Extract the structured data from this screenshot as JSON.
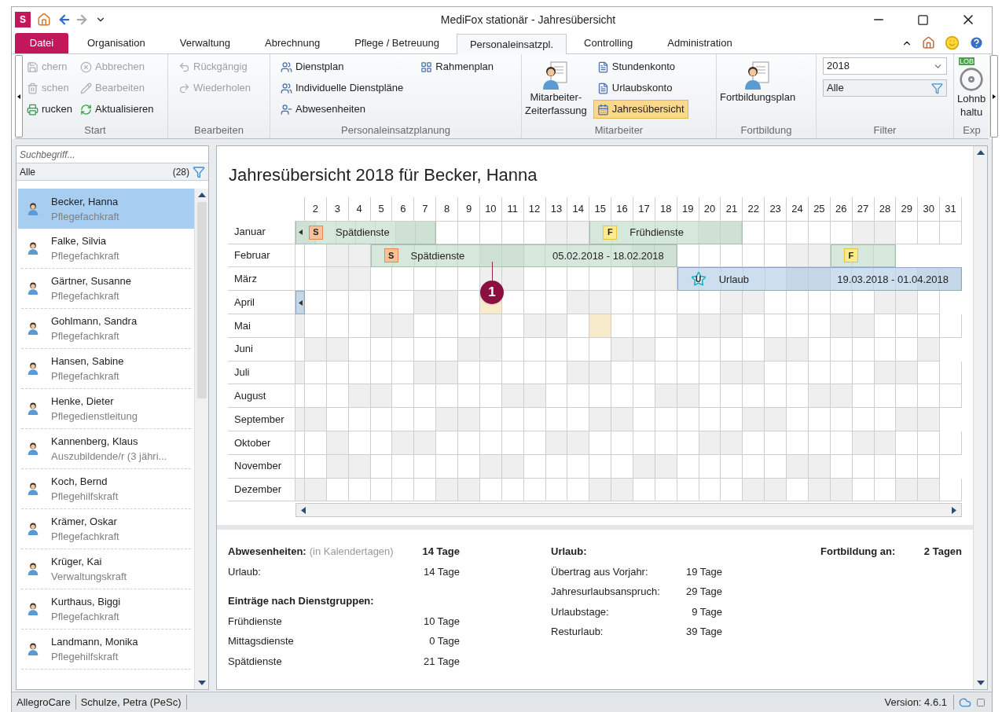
{
  "window": {
    "app_logo": "S",
    "title": "MediFox stationär - Jahresübersicht"
  },
  "tabs": [
    {
      "label": "Datei",
      "kind": "file",
      "selected": false
    },
    {
      "label": "Organisation",
      "kind": "tab",
      "selected": false
    },
    {
      "label": "Verwaltung",
      "kind": "tab",
      "selected": false
    },
    {
      "label": "Abrechnung",
      "kind": "tab",
      "selected": false
    },
    {
      "label": "Pflege / Betreuung",
      "kind": "tab",
      "selected": false
    },
    {
      "label": "Personaleinsatzpl.",
      "kind": "tab",
      "selected": true
    },
    {
      "label": "Controlling",
      "kind": "tab",
      "selected": false
    },
    {
      "label": "Administration",
      "kind": "tab",
      "selected": false
    }
  ],
  "ribbon": {
    "groups": [
      {
        "label": "Start",
        "columns": [
          {
            "kind": "stack",
            "items": [
              {
                "label": "chern",
                "disabled": true,
                "selected": false
              },
              {
                "label": "schen",
                "disabled": true,
                "selected": false
              },
              {
                "label": "rucken",
                "disabled": false,
                "selected": false
              }
            ]
          },
          {
            "kind": "stack",
            "items": [
              {
                "label": "Abbrechen",
                "disabled": true,
                "selected": false
              },
              {
                "label": "Bearbeiten",
                "disabled": true,
                "selected": false
              },
              {
                "label": "Aktualisieren",
                "disabled": false,
                "selected": false
              }
            ]
          }
        ]
      },
      {
        "label": "Bearbeiten",
        "columns": [
          {
            "kind": "stack",
            "items": [
              {
                "label": "Rückgängig",
                "disabled": true,
                "selected": false
              },
              {
                "label": "Wiederholen",
                "disabled": true,
                "selected": false
              }
            ]
          }
        ]
      },
      {
        "label": "Personaleinsatzplanung",
        "columns": [
          {
            "kind": "stack",
            "items": [
              {
                "label": "Dienstplan",
                "disabled": false,
                "selected": false
              },
              {
                "label": "Individuelle Dienstpläne",
                "disabled": false,
                "selected": false
              },
              {
                "label": "Abwesenheiten",
                "disabled": false,
                "selected": false
              }
            ]
          },
          {
            "kind": "stack",
            "items": [
              {
                "label": "Rahmenplan",
                "disabled": false,
                "selected": false
              }
            ]
          }
        ]
      },
      {
        "label": "Mitarbeiter",
        "columns": [
          {
            "kind": "large",
            "lines": [
              "Mitarbeiter-",
              "Zeiterfassung"
            ]
          },
          {
            "kind": "stack",
            "items": [
              {
                "label": "Stundenkonto",
                "disabled": false,
                "selected": false
              },
              {
                "label": "Urlaubskonto",
                "disabled": false,
                "selected": false
              },
              {
                "label": "Jahresübersicht",
                "disabled": false,
                "selected": true
              }
            ]
          }
        ]
      },
      {
        "label": "Fortbildung",
        "columns": [
          {
            "kind": "large",
            "lines": [
              "Fortbildungsplan"
            ]
          }
        ]
      },
      {
        "label": "Filter",
        "columns": [
          {
            "kind": "filter",
            "year": "2018",
            "scope": "Alle"
          }
        ]
      },
      {
        "label": "Exp",
        "columns": [
          {
            "kind": "large",
            "badge": "LOB",
            "lines": [
              "Lohnb",
              "haltu"
            ]
          }
        ]
      }
    ]
  },
  "sidebar": {
    "search": {
      "placeholder": "Suchbegriff..."
    },
    "filter": {
      "label": "Alle",
      "count": "(28)"
    },
    "items": [
      {
        "name": "Becker, Hanna",
        "role": "Pflegefachkraft",
        "selected": true
      },
      {
        "name": "Falke, Silvia",
        "role": "Pflegefachkraft",
        "selected": false
      },
      {
        "name": "Gärtner, Susanne",
        "role": "Pflegefachkraft",
        "selected": false
      },
      {
        "name": "Gohlmann, Sandra",
        "role": "Pflegefachkraft",
        "selected": false
      },
      {
        "name": "Hansen, Sabine",
        "role": "Pflegefachkraft",
        "selected": false
      },
      {
        "name": "Henke, Dieter",
        "role": "Pflegedienstleitung",
        "selected": false
      },
      {
        "name": "Kannenberg, Klaus",
        "role": "Auszubildende/r (3 jähri...",
        "selected": false
      },
      {
        "name": "Koch, Bernd",
        "role": "Pflegehilfskraft",
        "selected": false
      },
      {
        "name": "Krämer, Oskar",
        "role": "Pflegefachkraft",
        "selected": false
      },
      {
        "name": "Krüger, Kai",
        "role": "Verwaltungskraft",
        "selected": false
      },
      {
        "name": "Kurthaus, Biggi",
        "role": "Pflegefachkraft",
        "selected": false
      },
      {
        "name": "Landmann, Monika",
        "role": "Pflegehilfskraft",
        "selected": false
      }
    ]
  },
  "calendar": {
    "title": "Jahresübersicht 2018 für Becker, Hanna",
    "callout": "1",
    "days": [
      "2",
      "3",
      "4",
      "5",
      "6",
      "7",
      "8",
      "9",
      "10",
      "11",
      "12",
      "13",
      "14",
      "15",
      "16",
      "17",
      "18",
      "19",
      "20",
      "21",
      "22",
      "23",
      "24",
      "25",
      "26",
      "27",
      "28",
      "29",
      "30",
      "31"
    ],
    "months": [
      {
        "name": "Januar",
        "cells": [
          {
            "kind": "shift",
            "continues_left": true,
            "badge": {
              "kind": "late",
              "letter": "S"
            },
            "label": "Spätdienste",
            "days": [
              {
                "kind": "shaded"
              },
              {
                "kind": "plain"
              },
              {
                "kind": "plain"
              },
              {
                "kind": "plain"
              },
              {
                "kind": "plain"
              },
              {
                "kind": "shaded"
              },
              {
                "kind": "shaded"
              }
            ]
          },
          {
            "kind": "plain"
          },
          {
            "kind": "plain"
          },
          {
            "kind": "plain"
          },
          {
            "kind": "plain"
          },
          {
            "kind": "plain"
          },
          {
            "kind": "shaded"
          },
          {
            "kind": "shaded"
          },
          {
            "kind": "shift",
            "continues_left": false,
            "badge": {
              "kind": "early",
              "letter": "F"
            },
            "label": "Frühdienste",
            "days": [
              {
                "kind": "plain"
              },
              {
                "kind": "plain"
              },
              {
                "kind": "plain"
              },
              {
                "kind": "plain"
              },
              {
                "kind": "plain"
              },
              {
                "kind": "shaded"
              },
              {
                "kind": "shaded"
              }
            ]
          },
          {
            "kind": "plain"
          },
          {
            "kind": "plain"
          },
          {
            "kind": "plain"
          },
          {
            "kind": "plain"
          },
          {
            "kind": "plain"
          },
          {
            "kind": "shaded"
          },
          {
            "kind": "shaded"
          },
          {
            "kind": "plain"
          },
          {
            "kind": "plain"
          },
          {
            "kind": "plain"
          }
        ]
      },
      {
        "name": "Februar",
        "cells": [
          {
            "kind": "plain"
          },
          {
            "kind": "plain"
          },
          {
            "kind": "shaded"
          },
          {
            "kind": "shaded"
          },
          {
            "kind": "shift",
            "continues_left": false,
            "badge": {
              "kind": "late",
              "letter": "S"
            },
            "label": "Spätdienste",
            "range": "05.02.2018 - 18.02.2018",
            "days": [
              {
                "kind": "plain"
              },
              {
                "kind": "plain"
              },
              {
                "kind": "plain"
              },
              {
                "kind": "plain"
              },
              {
                "kind": "plain"
              },
              {
                "kind": "shaded"
              },
              {
                "kind": "shaded"
              },
              {
                "kind": "plain"
              },
              {
                "kind": "plain"
              },
              {
                "kind": "plain"
              },
              {
                "kind": "plain"
              },
              {
                "kind": "plain"
              },
              {
                "kind": "shaded"
              },
              {
                "kind": "shaded"
              }
            ]
          },
          {
            "kind": "plain"
          },
          {
            "kind": "plain"
          },
          {
            "kind": "plain"
          },
          {
            "kind": "plain"
          },
          {
            "kind": "plain"
          },
          {
            "kind": "shaded"
          },
          {
            "kind": "shaded"
          },
          {
            "kind": "shift",
            "continues_left": false,
            "badge": {
              "kind": "early",
              "letter": "F"
            },
            "days": [
              {
                "kind": "plain"
              },
              {
                "kind": "plain"
              },
              {
                "kind": "plain"
              }
            ]
          }
        ]
      },
      {
        "name": "März",
        "cells": [
          {
            "kind": "plain"
          },
          {
            "kind": "plain"
          },
          {
            "kind": "shaded"
          },
          {
            "kind": "shaded"
          },
          {
            "kind": "plain"
          },
          {
            "kind": "plain"
          },
          {
            "kind": "plain"
          },
          {
            "kind": "plain"
          },
          {
            "kind": "plain"
          },
          {
            "kind": "shaded"
          },
          {
            "kind": "shaded"
          },
          {
            "kind": "plain"
          },
          {
            "kind": "plain"
          },
          {
            "kind": "plain"
          },
          {
            "kind": "plain"
          },
          {
            "kind": "plain"
          },
          {
            "kind": "shaded"
          },
          {
            "kind": "shaded"
          },
          {
            "kind": "vacation",
            "continues_left": false,
            "badge": {
              "kind": "vacation",
              "letter": "U"
            },
            "label": "Urlaub",
            "range": "19.03.2018 - 01.04.2018",
            "days": [
              {
                "kind": "plain"
              },
              {
                "kind": "plain"
              },
              {
                "kind": "plain"
              },
              {
                "kind": "plain"
              },
              {
                "kind": "plain"
              },
              {
                "kind": "shaded"
              },
              {
                "kind": "shaded"
              },
              {
                "kind": "plain"
              },
              {
                "kind": "plain"
              },
              {
                "kind": "plain"
              },
              {
                "kind": "plain"
              },
              {
                "kind": "shaded"
              },
              {
                "kind": "shaded"
              }
            ]
          }
        ]
      },
      {
        "name": "April",
        "cells": [
          {
            "kind": "vacation",
            "continues_left": true,
            "days": [
              {
                "kind": "shaded"
              }
            ]
          },
          {
            "kind": "plain"
          },
          {
            "kind": "plain"
          },
          {
            "kind": "plain"
          },
          {
            "kind": "plain"
          },
          {
            "kind": "plain"
          },
          {
            "kind": "shaded"
          },
          {
            "kind": "shaded"
          },
          {
            "kind": "plain"
          },
          {
            "kind": "marked"
          },
          {
            "kind": "plain"
          },
          {
            "kind": "plain"
          },
          {
            "kind": "plain"
          },
          {
            "kind": "shaded"
          },
          {
            "kind": "shaded"
          },
          {
            "kind": "plain"
          },
          {
            "kind": "plain"
          },
          {
            "kind": "plain"
          },
          {
            "kind": "plain"
          },
          {
            "kind": "plain"
          },
          {
            "kind": "shaded"
          },
          {
            "kind": "shaded"
          },
          {
            "kind": "plain"
          },
          {
            "kind": "plain"
          },
          {
            "kind": "plain"
          },
          {
            "kind": "plain"
          },
          {
            "kind": "plain"
          },
          {
            "kind": "shaded"
          },
          {
            "kind": "shaded"
          },
          {
            "kind": "plain"
          }
        ]
      },
      {
        "name": "Mai",
        "cells": [
          {
            "kind": "shaded"
          },
          {
            "kind": "plain"
          },
          {
            "kind": "plain"
          },
          {
            "kind": "plain"
          },
          {
            "kind": "shaded"
          },
          {
            "kind": "shaded"
          },
          {
            "kind": "plain"
          },
          {
            "kind": "plain"
          },
          {
            "kind": "plain"
          },
          {
            "kind": "shaded"
          },
          {
            "kind": "plain"
          },
          {
            "kind": "shaded"
          },
          {
            "kind": "shaded"
          },
          {
            "kind": "plain"
          },
          {
            "kind": "marked"
          },
          {
            "kind": "plain"
          },
          {
            "kind": "plain"
          },
          {
            "kind": "plain"
          },
          {
            "kind": "shaded"
          },
          {
            "kind": "shaded"
          },
          {
            "kind": "shaded"
          },
          {
            "kind": "plain"
          },
          {
            "kind": "plain"
          },
          {
            "kind": "plain"
          },
          {
            "kind": "plain"
          },
          {
            "kind": "shaded"
          },
          {
            "kind": "shaded"
          },
          {
            "kind": "plain"
          },
          {
            "kind": "plain"
          },
          {
            "kind": "plain"
          },
          {
            "kind": "plain"
          }
        ]
      },
      {
        "name": "Juni",
        "cells": [
          {
            "kind": "plain"
          },
          {
            "kind": "shaded"
          },
          {
            "kind": "shaded"
          },
          {
            "kind": "plain"
          },
          {
            "kind": "plain"
          },
          {
            "kind": "plain"
          },
          {
            "kind": "plain"
          },
          {
            "kind": "plain"
          },
          {
            "kind": "shaded"
          },
          {
            "kind": "shaded"
          },
          {
            "kind": "plain"
          },
          {
            "kind": "plain"
          },
          {
            "kind": "plain"
          },
          {
            "kind": "plain"
          },
          {
            "kind": "plain"
          },
          {
            "kind": "shaded"
          },
          {
            "kind": "shaded"
          },
          {
            "kind": "plain"
          },
          {
            "kind": "plain"
          },
          {
            "kind": "plain"
          },
          {
            "kind": "plain"
          },
          {
            "kind": "plain"
          },
          {
            "kind": "shaded"
          },
          {
            "kind": "shaded"
          },
          {
            "kind": "plain"
          },
          {
            "kind": "plain"
          },
          {
            "kind": "plain"
          },
          {
            "kind": "plain"
          },
          {
            "kind": "plain"
          },
          {
            "kind": "shaded"
          }
        ]
      },
      {
        "name": "Juli",
        "cells": [
          {
            "kind": "shaded"
          },
          {
            "kind": "plain"
          },
          {
            "kind": "plain"
          },
          {
            "kind": "plain"
          },
          {
            "kind": "plain"
          },
          {
            "kind": "plain"
          },
          {
            "kind": "shaded"
          },
          {
            "kind": "shaded"
          },
          {
            "kind": "plain"
          },
          {
            "kind": "plain"
          },
          {
            "kind": "plain"
          },
          {
            "kind": "plain"
          },
          {
            "kind": "plain"
          },
          {
            "kind": "shaded"
          },
          {
            "kind": "shaded"
          },
          {
            "kind": "plain"
          },
          {
            "kind": "plain"
          },
          {
            "kind": "plain"
          },
          {
            "kind": "plain"
          },
          {
            "kind": "plain"
          },
          {
            "kind": "shaded"
          },
          {
            "kind": "shaded"
          },
          {
            "kind": "plain"
          },
          {
            "kind": "plain"
          },
          {
            "kind": "plain"
          },
          {
            "kind": "plain"
          },
          {
            "kind": "plain"
          },
          {
            "kind": "shaded"
          },
          {
            "kind": "shaded"
          },
          {
            "kind": "plain"
          },
          {
            "kind": "plain"
          }
        ]
      },
      {
        "name": "August",
        "cells": [
          {
            "kind": "plain"
          },
          {
            "kind": "plain"
          },
          {
            "kind": "plain"
          },
          {
            "kind": "shaded"
          },
          {
            "kind": "shaded"
          },
          {
            "kind": "plain"
          },
          {
            "kind": "plain"
          },
          {
            "kind": "plain"
          },
          {
            "kind": "plain"
          },
          {
            "kind": "plain"
          },
          {
            "kind": "shaded"
          },
          {
            "kind": "shaded"
          },
          {
            "kind": "plain"
          },
          {
            "kind": "plain"
          },
          {
            "kind": "plain"
          },
          {
            "kind": "plain"
          },
          {
            "kind": "plain"
          },
          {
            "kind": "shaded"
          },
          {
            "kind": "shaded"
          },
          {
            "kind": "plain"
          },
          {
            "kind": "plain"
          },
          {
            "kind": "plain"
          },
          {
            "kind": "plain"
          },
          {
            "kind": "plain"
          },
          {
            "kind": "shaded"
          },
          {
            "kind": "shaded"
          },
          {
            "kind": "plain"
          },
          {
            "kind": "plain"
          },
          {
            "kind": "plain"
          },
          {
            "kind": "plain"
          },
          {
            "kind": "plain"
          }
        ]
      },
      {
        "name": "September",
        "cells": [
          {
            "kind": "shaded"
          },
          {
            "kind": "shaded"
          },
          {
            "kind": "plain"
          },
          {
            "kind": "plain"
          },
          {
            "kind": "plain"
          },
          {
            "kind": "plain"
          },
          {
            "kind": "plain"
          },
          {
            "kind": "shaded"
          },
          {
            "kind": "shaded"
          },
          {
            "kind": "plain"
          },
          {
            "kind": "plain"
          },
          {
            "kind": "plain"
          },
          {
            "kind": "plain"
          },
          {
            "kind": "plain"
          },
          {
            "kind": "shaded"
          },
          {
            "kind": "shaded"
          },
          {
            "kind": "plain"
          },
          {
            "kind": "plain"
          },
          {
            "kind": "plain"
          },
          {
            "kind": "plain"
          },
          {
            "kind": "plain"
          },
          {
            "kind": "shaded"
          },
          {
            "kind": "shaded"
          },
          {
            "kind": "plain"
          },
          {
            "kind": "plain"
          },
          {
            "kind": "plain"
          },
          {
            "kind": "plain"
          },
          {
            "kind": "plain"
          },
          {
            "kind": "shaded"
          },
          {
            "kind": "shaded"
          }
        ]
      },
      {
        "name": "Oktober",
        "cells": [
          {
            "kind": "plain"
          },
          {
            "kind": "plain"
          },
          {
            "kind": "shaded"
          },
          {
            "kind": "plain"
          },
          {
            "kind": "plain"
          },
          {
            "kind": "shaded"
          },
          {
            "kind": "shaded"
          },
          {
            "kind": "plain"
          },
          {
            "kind": "plain"
          },
          {
            "kind": "plain"
          },
          {
            "kind": "plain"
          },
          {
            "kind": "plain"
          },
          {
            "kind": "shaded"
          },
          {
            "kind": "shaded"
          },
          {
            "kind": "plain"
          },
          {
            "kind": "plain"
          },
          {
            "kind": "plain"
          },
          {
            "kind": "plain"
          },
          {
            "kind": "plain"
          },
          {
            "kind": "shaded"
          },
          {
            "kind": "shaded"
          },
          {
            "kind": "plain"
          },
          {
            "kind": "plain"
          },
          {
            "kind": "plain"
          },
          {
            "kind": "plain"
          },
          {
            "kind": "plain"
          },
          {
            "kind": "shaded"
          },
          {
            "kind": "shaded"
          },
          {
            "kind": "plain"
          },
          {
            "kind": "plain"
          },
          {
            "kind": "plain"
          }
        ]
      },
      {
        "name": "November",
        "cells": [
          {
            "kind": "plain"
          },
          {
            "kind": "plain"
          },
          {
            "kind": "shaded"
          },
          {
            "kind": "shaded"
          },
          {
            "kind": "plain"
          },
          {
            "kind": "plain"
          },
          {
            "kind": "plain"
          },
          {
            "kind": "plain"
          },
          {
            "kind": "plain"
          },
          {
            "kind": "shaded"
          },
          {
            "kind": "shaded"
          },
          {
            "kind": "plain"
          },
          {
            "kind": "plain"
          },
          {
            "kind": "plain"
          },
          {
            "kind": "plain"
          },
          {
            "kind": "plain"
          },
          {
            "kind": "shaded"
          },
          {
            "kind": "shaded"
          },
          {
            "kind": "plain"
          },
          {
            "kind": "plain"
          },
          {
            "kind": "plain"
          },
          {
            "kind": "plain"
          },
          {
            "kind": "plain"
          },
          {
            "kind": "shaded"
          },
          {
            "kind": "shaded"
          },
          {
            "kind": "plain"
          },
          {
            "kind": "plain"
          },
          {
            "kind": "plain"
          },
          {
            "kind": "plain"
          },
          {
            "kind": "plain"
          }
        ]
      },
      {
        "name": "Dezember",
        "cells": [
          {
            "kind": "shaded"
          },
          {
            "kind": "shaded"
          },
          {
            "kind": "plain"
          },
          {
            "kind": "plain"
          },
          {
            "kind": "plain"
          },
          {
            "kind": "plain"
          },
          {
            "kind": "plain"
          },
          {
            "kind": "shaded"
          },
          {
            "kind": "shaded"
          },
          {
            "kind": "plain"
          },
          {
            "kind": "plain"
          },
          {
            "kind": "plain"
          },
          {
            "kind": "plain"
          },
          {
            "kind": "plain"
          },
          {
            "kind": "shaded"
          },
          {
            "kind": "shaded"
          },
          {
            "kind": "plain"
          },
          {
            "kind": "plain"
          },
          {
            "kind": "plain"
          },
          {
            "kind": "plain"
          },
          {
            "kind": "plain"
          },
          {
            "kind": "shaded"
          },
          {
            "kind": "shaded"
          },
          {
            "kind": "plain"
          },
          {
            "kind": "shaded"
          },
          {
            "kind": "shaded"
          },
          {
            "kind": "plain"
          },
          {
            "kind": "plain"
          },
          {
            "kind": "shaded"
          },
          {
            "kind": "shaded"
          },
          {
            "kind": "plain"
          }
        ]
      }
    ]
  },
  "summary": {
    "columns": [
      [
        {
          "kind": "header",
          "label": "Abwesenheiten:",
          "note": "(in Kalendertagen)",
          "value": "14 Tage"
        },
        {
          "kind": "row",
          "label": "Urlaub:",
          "value": "14 Tage"
        },
        {
          "kind": "heading",
          "label": "Einträge nach Dienstgruppen:"
        },
        {
          "kind": "row",
          "label": "Frühdienste",
          "value": "10 Tage"
        },
        {
          "kind": "row",
          "label": "Mittagsdienste",
          "value": "0 Tage"
        },
        {
          "kind": "row",
          "label": "Spätdienste",
          "value": "21 Tage"
        }
      ],
      [
        {
          "kind": "header",
          "label": "Urlaub:"
        },
        {
          "kind": "row",
          "label": "Übertrag aus Vorjahr:",
          "value": "19 Tage"
        },
        {
          "kind": "row",
          "label": "Jahresurlaubsanspruch:",
          "value": "29 Tage"
        },
        {
          "kind": "row",
          "label": "Urlaubstage:",
          "value": "9 Tage"
        },
        {
          "kind": "row",
          "label": "Resturlaub:",
          "value": "39 Tage"
        }
      ],
      [
        {
          "kind": "header",
          "label": "Fortbildung an:",
          "value": "2 Tagen"
        }
      ]
    ]
  },
  "status_bar": {
    "left": [
      "AllegroCare",
      "Schulze, Petra (PeSc)"
    ],
    "version": "Version: 4.6.1"
  }
}
